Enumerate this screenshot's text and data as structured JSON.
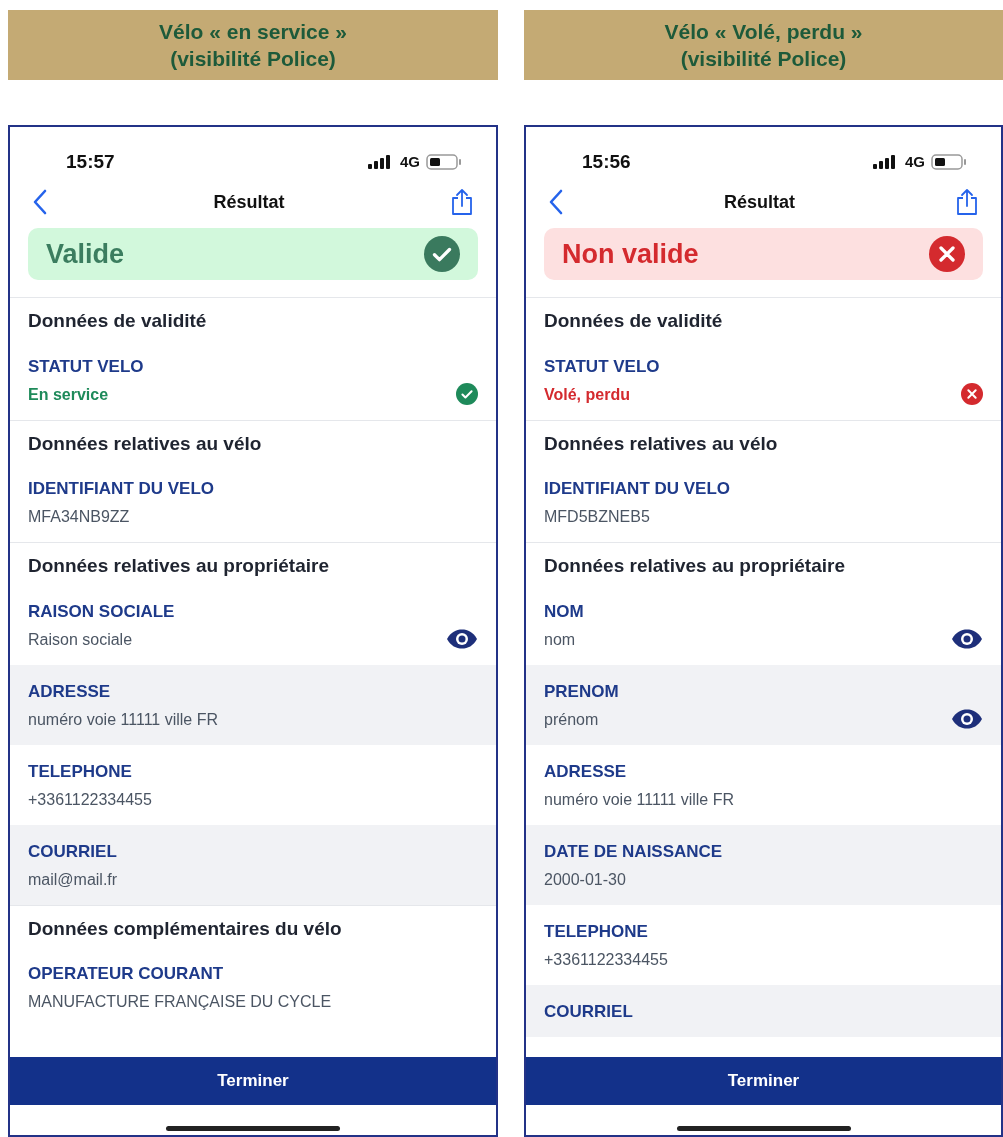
{
  "panels": [
    {
      "caption": [
        "Vélo « en service »",
        "(visibilité Police)"
      ],
      "status_bar": {
        "time": "15:57",
        "network": "4G"
      },
      "nav": {
        "title": "Résultat"
      },
      "banner": {
        "label": "Valide",
        "valid": true
      },
      "sections": [
        {
          "heading": "Données de validité",
          "fields": [
            {
              "label": "STATUT VELO",
              "value": "En service",
              "kind": "status",
              "valid": true,
              "shaded": false,
              "revealable": false
            }
          ]
        },
        {
          "heading": "Données relatives au vélo",
          "fields": [
            {
              "label": "IDENTIFIANT DU VELO",
              "value": "MFA34NB9ZZ",
              "kind": "text",
              "shaded": false,
              "revealable": false
            }
          ]
        },
        {
          "heading": "Données relatives au propriétaire",
          "fields": [
            {
              "label": "RAISON SOCIALE",
              "value": "Raison sociale",
              "kind": "text",
              "shaded": false,
              "revealable": true
            },
            {
              "label": "ADRESSE",
              "value": "numéro voie 11111 ville FR",
              "kind": "text",
              "shaded": true,
              "revealable": false
            },
            {
              "label": "TELEPHONE",
              "value": "+3361122334455",
              "kind": "text",
              "shaded": false,
              "revealable": false
            },
            {
              "label": "COURRIEL",
              "value": "mail@mail.fr",
              "kind": "text",
              "shaded": true,
              "revealable": false
            }
          ]
        },
        {
          "heading": "Données complémentaires du vélo",
          "fields": [
            {
              "label": "OPERATEUR COURANT",
              "value": "MANUFACTURE FRANÇAISE DU CYCLE",
              "kind": "text",
              "shaded": false,
              "revealable": false
            }
          ]
        }
      ],
      "button": "Terminer"
    },
    {
      "caption": [
        "Vélo « Volé, perdu »",
        "(visibilité Police)"
      ],
      "status_bar": {
        "time": "15:56",
        "network": "4G"
      },
      "nav": {
        "title": "Résultat"
      },
      "banner": {
        "label": "Non valide",
        "valid": false
      },
      "sections": [
        {
          "heading": "Données de validité",
          "fields": [
            {
              "label": "STATUT VELO",
              "value": "Volé, perdu",
              "kind": "status",
              "valid": false,
              "shaded": false,
              "revealable": false
            }
          ]
        },
        {
          "heading": "Données relatives au vélo",
          "fields": [
            {
              "label": "IDENTIFIANT DU VELO",
              "value": "MFD5BZNEB5",
              "kind": "text",
              "shaded": false,
              "revealable": false
            }
          ]
        },
        {
          "heading": "Données relatives au propriétaire",
          "fields": [
            {
              "label": "NOM",
              "value": "nom",
              "kind": "text",
              "shaded": false,
              "revealable": true
            },
            {
              "label": "PRENOM",
              "value": "prénom",
              "kind": "text",
              "shaded": true,
              "revealable": true
            },
            {
              "label": "ADRESSE",
              "value": "numéro voie 11111 ville FR",
              "kind": "text",
              "shaded": false,
              "revealable": false
            },
            {
              "label": "DATE DE NAISSANCE",
              "value": "2000-01-30",
              "kind": "text",
              "shaded": true,
              "revealable": false
            },
            {
              "label": "TELEPHONE",
              "value": "+3361122334455",
              "kind": "text",
              "shaded": false,
              "revealable": false
            },
            {
              "label": "COURRIEL",
              "kind": "text",
              "shaded": true,
              "revealable": false
            }
          ]
        }
      ],
      "button": "Terminer"
    }
  ]
}
